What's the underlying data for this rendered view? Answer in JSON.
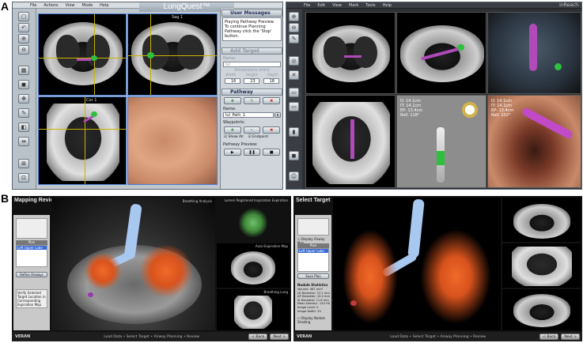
{
  "labels": {
    "a": "A",
    "b": "B"
  },
  "topLeft": {
    "menu": [
      "File",
      "Actions",
      "View",
      "Mode",
      "Help"
    ],
    "appTitle": "LungQuest™",
    "viewLabels": {
      "sag": "Sag 1",
      "cor": "Cor 1"
    },
    "userMessages": {
      "heading": "User Messages",
      "text": "Playing Pathway Preview. To continue Planning Pathway click the 'Stop' button."
    },
    "addTarget": {
      "heading": "Add Target",
      "nameLabel": "Name:",
      "nameValue": "lul",
      "dimensionsLabel": "Dimensions (mm)",
      "dimHeaders": [
        "Width",
        "Height",
        "Depth"
      ],
      "dimValues": [
        "16",
        "23",
        "18"
      ]
    },
    "pathway": {
      "heading": "Pathway",
      "nameLabel": "Name:",
      "nameValue": "lul_Path_1",
      "waypointsLabel": "Waypoints:",
      "checks": [
        "Show All",
        "Endpoint"
      ],
      "previewLabel": "Pathway Preview:"
    }
  },
  "topRight": {
    "menu": [
      "File",
      "Edit",
      "View",
      "Mark",
      "Tools",
      "Help"
    ],
    "brand": "inReach",
    "overlay1": [
      "D: 14.1cm",
      "IT: 14.1cm",
      "EP: 13.4cm",
      "Roll: 118°"
    ],
    "overlay2": [
      "D: 14.1cm",
      "IT: 14.1cm",
      "EP: 13.4cm",
      "Roll: 102°"
    ]
  },
  "bottomLeft": {
    "title": "Mapping Review",
    "hdr1": "Breathing Analysis",
    "hdr2": "Lumen Registered Inspiration Expiration",
    "hdr3": "Axial Expiration Map",
    "hdr4": "Breathing Lung",
    "listHeader": "Plan",
    "listItem": "Left Upper Lobe",
    "refineBtn": "Refine Airways",
    "verifyText": "Verify Selected Target Location in Corresponding Expiration Map",
    "brand": "VERAN",
    "steps": "Load Data • Select Target • Airway Planning • Review",
    "back": "< Back",
    "next": "Next >"
  },
  "bottomRight": {
    "title": "Select Target",
    "displayAirway": "Display Airway Map",
    "listHeader": "Plan",
    "listItem": "Left Upper Lobe",
    "saveBtn": "Save Plan",
    "statsTitle": "Nodule Statistics",
    "stats": [
      "Volume: 987 mm³",
      "LR Diameter: 12.1 mm",
      "AP Diameter: 10.4 mm",
      "SI Diameter: 11.6 mm",
      "Mean Density: -124 HU",
      "Image Level: 0",
      "Image Width: 20"
    ],
    "displayNodule": "Display Nodule Shading",
    "brand": "VERAN",
    "steps": "Load Data • Select Target • Airway Planning • Review",
    "back": "< Back",
    "next": "Next >"
  },
  "colors": {
    "airway": "#f06a2a",
    "trachea": "#a8c8f0",
    "target": "#2fbf3f",
    "path": "#b04ab8"
  }
}
